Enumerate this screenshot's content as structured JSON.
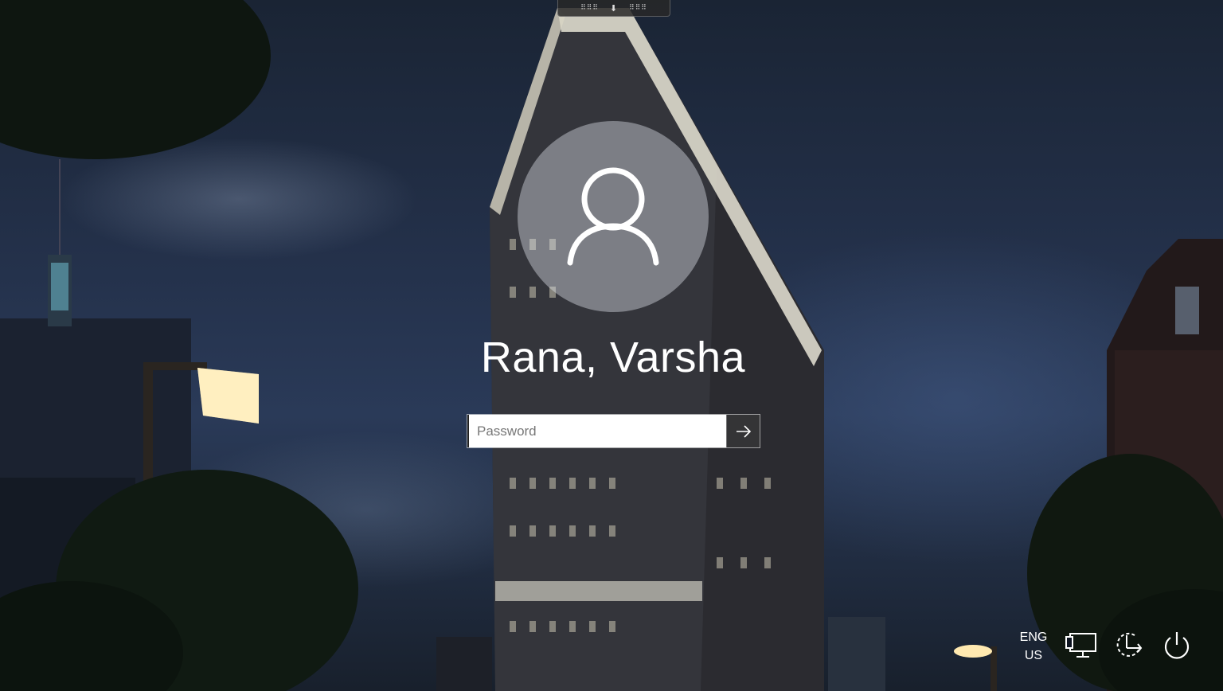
{
  "top_bar": {
    "handle_glyph": "⬇"
  },
  "user": {
    "name": "Rana, Varsha",
    "avatar_icon": "user-avatar-icon"
  },
  "password": {
    "placeholder": "Password",
    "value": "",
    "submit_icon": "arrow-right-icon"
  },
  "tray": {
    "language_line1": "ENG",
    "language_line2": "US",
    "network_icon": "network-icon",
    "accessibility_icon": "ease-of-access-icon",
    "power_icon": "power-icon"
  }
}
